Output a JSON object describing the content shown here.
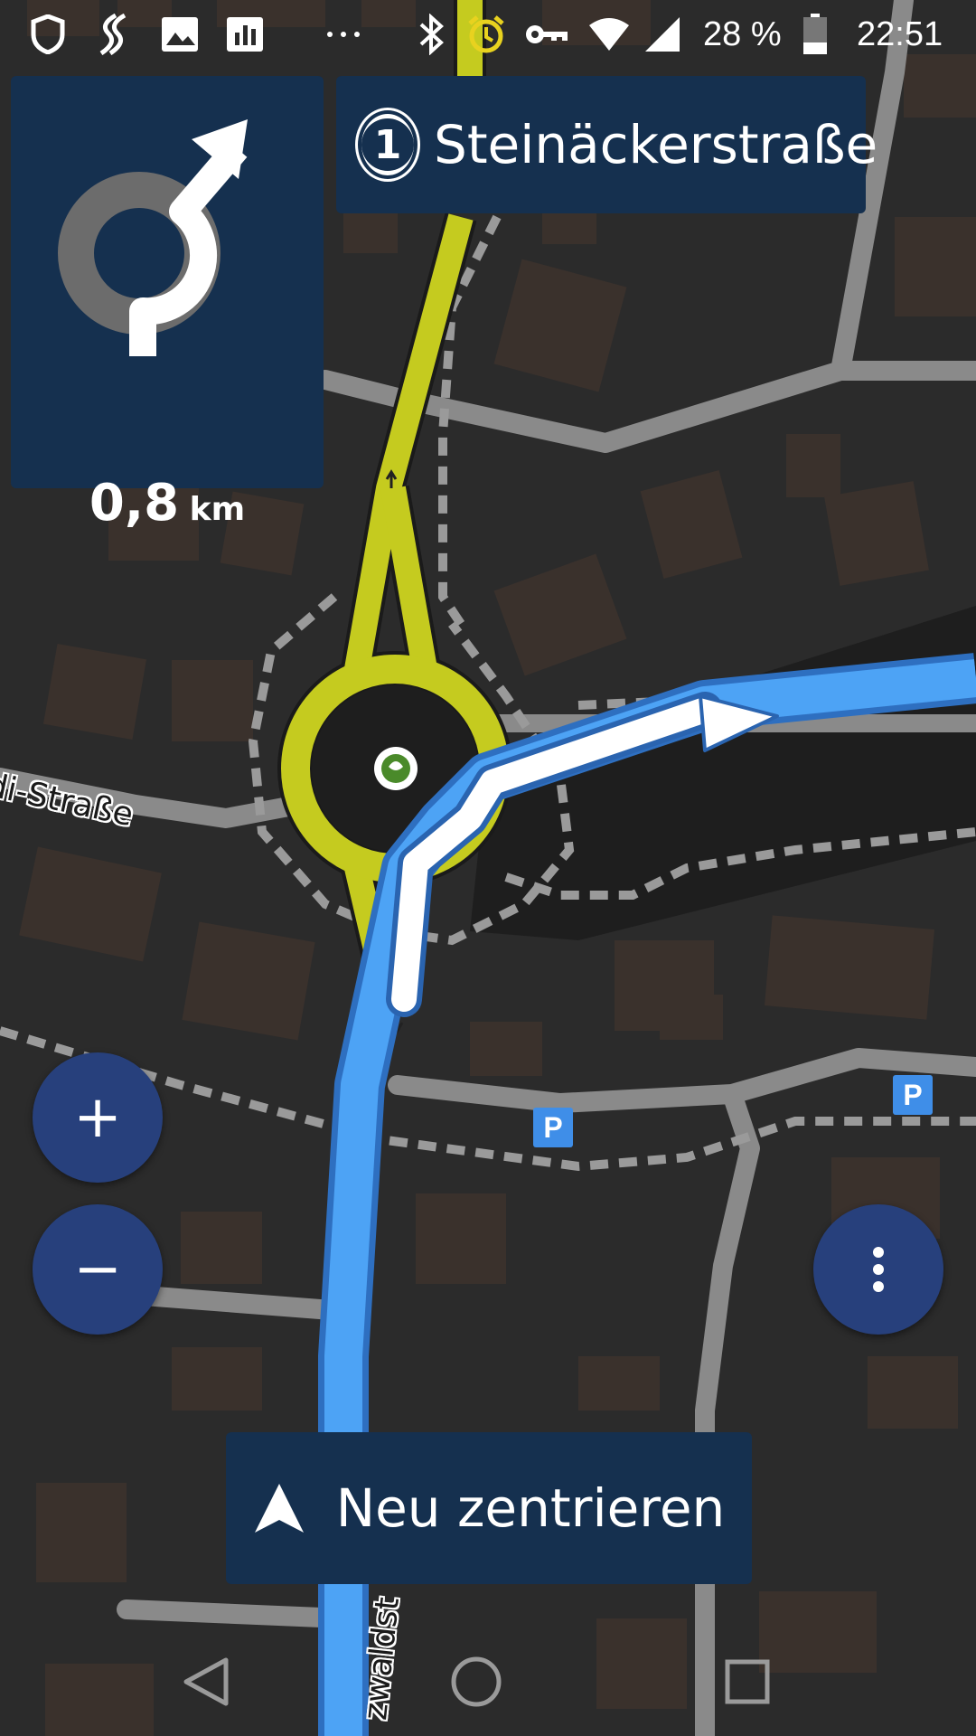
{
  "status_bar": {
    "battery": "28 %",
    "time": "22:51",
    "icons": [
      "shield-icon",
      "route-icon",
      "image-icon",
      "chart-icon",
      "more-dots-icon",
      "bluetooth-icon",
      "alarm-icon",
      "vpn-key-icon",
      "wifi-icon",
      "signal-icon",
      "battery-icon"
    ]
  },
  "maneuver": {
    "icon": "roundabout-exit-icon",
    "distance_value": "0,8",
    "distance_unit": "km"
  },
  "next_street": {
    "exit_number": "1",
    "name": "Steinäckerstraße"
  },
  "map": {
    "street_labels": {
      "left": "di-Straße",
      "bottom": "zwaldst"
    },
    "parking_label": "P",
    "colors": {
      "background": "#2b2b2b",
      "road": "#8a8a8a",
      "route": "#4da3f5",
      "highlight_road": "#c5cb1f",
      "building": "#3a312c"
    }
  },
  "controls": {
    "zoom_in": "+",
    "zoom_out": "−",
    "menu_icon": "more-vert-icon",
    "recenter_label": "Neu zentrieren",
    "recenter_icon": "navigation-arrow-icon"
  },
  "nav_bar": {
    "back_icon": "back-triangle-icon",
    "home_icon": "home-circle-icon",
    "recents_icon": "recents-square-icon"
  }
}
